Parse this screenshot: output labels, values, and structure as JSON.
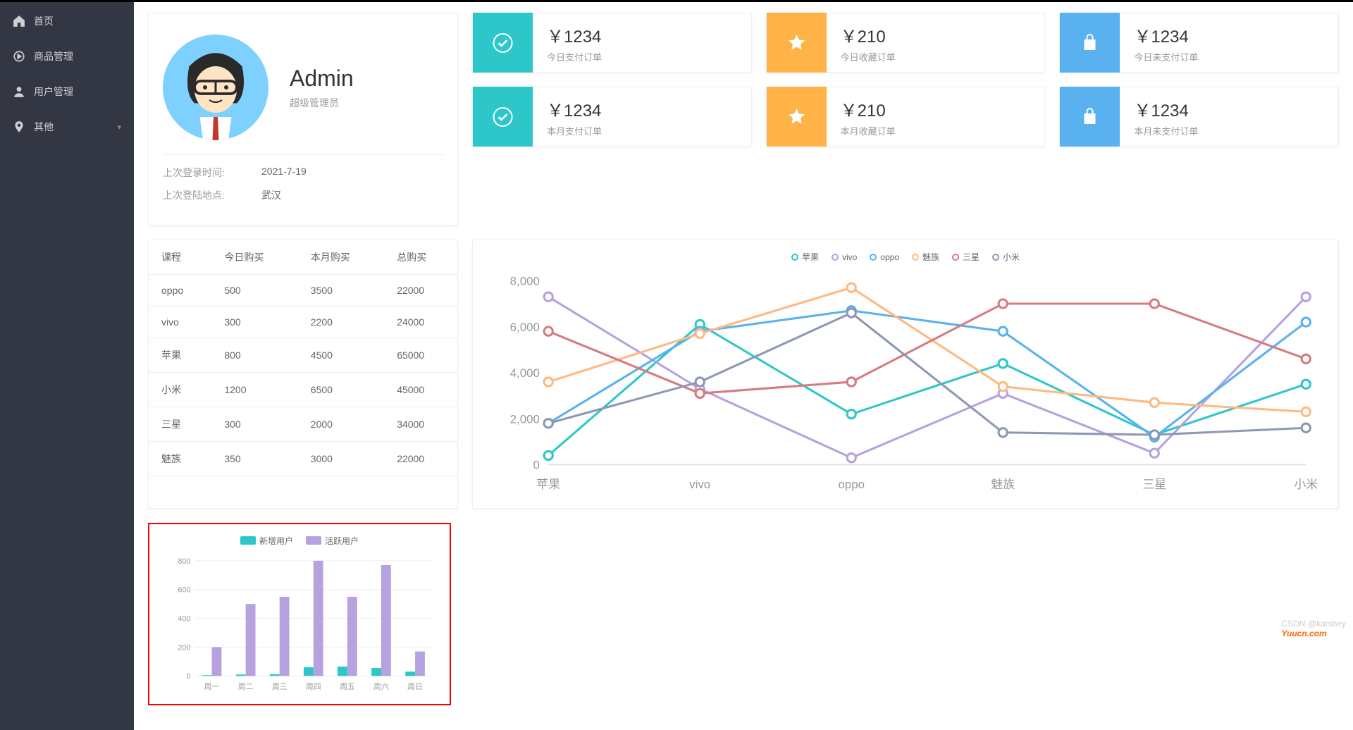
{
  "sidebar": {
    "items": [
      {
        "label": "首页"
      },
      {
        "label": "商品管理"
      },
      {
        "label": "用户管理"
      },
      {
        "label": "其他"
      }
    ]
  },
  "profile": {
    "name": "Admin",
    "role": "超级管理员",
    "last_login_time_label": "上次登录时间:",
    "last_login_time": "2021-7-19",
    "last_login_location_label": "上次登陆地点:",
    "last_login_location": "武汉"
  },
  "stats": [
    {
      "icon": "check",
      "color": "teal",
      "value": "￥1234",
      "label": "今日支付订单"
    },
    {
      "icon": "star",
      "color": "orange",
      "value": "￥210",
      "label": "今日收藏订单"
    },
    {
      "icon": "bag",
      "color": "blue",
      "value": "￥1234",
      "label": "今日未支付订单"
    },
    {
      "icon": "check",
      "color": "teal",
      "value": "￥1234",
      "label": "本月支付订单"
    },
    {
      "icon": "star",
      "color": "orange",
      "value": "￥210",
      "label": "本月收藏订单"
    },
    {
      "icon": "bag",
      "color": "blue",
      "value": "￥1234",
      "label": "本月未支付订单"
    }
  ],
  "table": {
    "headers": [
      "课程",
      "今日购买",
      "本月购买",
      "总购买"
    ],
    "rows": [
      [
        "oppo",
        "500",
        "3500",
        "22000"
      ],
      [
        "vivo",
        "300",
        "2200",
        "24000"
      ],
      [
        "苹果",
        "800",
        "4500",
        "65000"
      ],
      [
        "小米",
        "1200",
        "6500",
        "45000"
      ],
      [
        "三星",
        "300",
        "2000",
        "34000"
      ],
      [
        "魅族",
        "350",
        "3000",
        "22000"
      ]
    ]
  },
  "chart_data": [
    {
      "type": "line",
      "categories": [
        "苹果",
        "vivo",
        "oppo",
        "魅族",
        "三星",
        "小米"
      ],
      "ylim": [
        0,
        8000
      ],
      "yticks": [
        0,
        2000,
        4000,
        6000,
        8000
      ],
      "series": [
        {
          "name": "苹果",
          "color": "#2ec7c9",
          "values": [
            400,
            6100,
            2200,
            4400,
            1300,
            3500
          ]
        },
        {
          "name": "vivo",
          "color": "#b6a2de",
          "values": [
            7300,
            3300,
            300,
            3100,
            500,
            7300
          ]
        },
        {
          "name": "oppo",
          "color": "#5ab1ef",
          "values": [
            1800,
            5800,
            6700,
            5800,
            1200,
            6200
          ]
        },
        {
          "name": "魅族",
          "color": "#ffb980",
          "values": [
            3600,
            5700,
            7700,
            3400,
            2700,
            2300
          ]
        },
        {
          "name": "三星",
          "color": "#d87a80",
          "values": [
            5800,
            3100,
            3600,
            7000,
            7000,
            4600
          ]
        },
        {
          "name": "小米",
          "color": "#8d98b3",
          "values": [
            1800,
            3600,
            6600,
            1400,
            1300,
            1600
          ]
        }
      ]
    },
    {
      "type": "bar",
      "categories": [
        "周一",
        "周二",
        "周三",
        "周四",
        "周五",
        "周六",
        "周日"
      ],
      "ylim": [
        0,
        800
      ],
      "yticks": [
        0,
        200,
        400,
        600,
        800
      ],
      "series": [
        {
          "name": "新增用户",
          "color": "#2ec7c9",
          "values": [
            5,
            10,
            12,
            60,
            65,
            55,
            30
          ]
        },
        {
          "name": "活跃用户",
          "color": "#b6a2de",
          "values": [
            200,
            500,
            550,
            800,
            550,
            770,
            170
          ]
        }
      ]
    }
  ],
  "watermark": {
    "csdn": "CSDN @karshey",
    "site": "Yuucn.com"
  }
}
